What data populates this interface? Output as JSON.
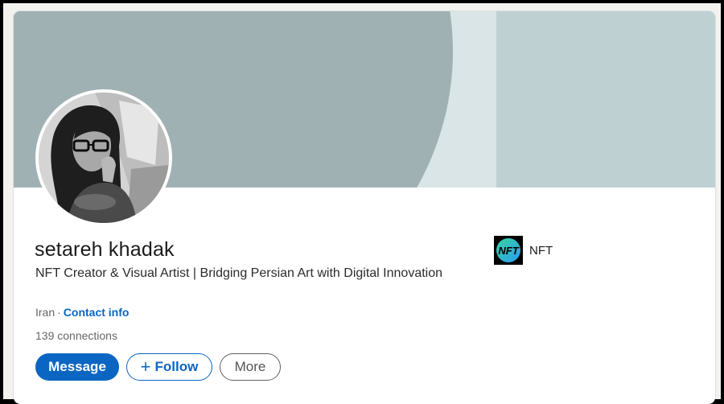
{
  "profile": {
    "name": "setareh khadak",
    "headline": "NFT Creator & Visual Artist | Bridging Persian Art with Digital Innovation",
    "location": "Iran",
    "separator": "·",
    "contact_info": "Contact info",
    "connections": "139 connections"
  },
  "actions": {
    "message": "Message",
    "follow_icon": "+",
    "follow": "Follow",
    "more": "More"
  },
  "organization": {
    "logo_text": "NFT",
    "name": "NFT"
  },
  "icons": {
    "follow": "plus-icon",
    "org_logo": "nft-logo"
  },
  "colors": {
    "accent": "#0a66c2",
    "banner_dark": "#a0b1b4",
    "banner_light": "#d9e5e7",
    "banner_right": "#bfd0d3",
    "text": "#1b1b1b",
    "muted": "#666666"
  }
}
